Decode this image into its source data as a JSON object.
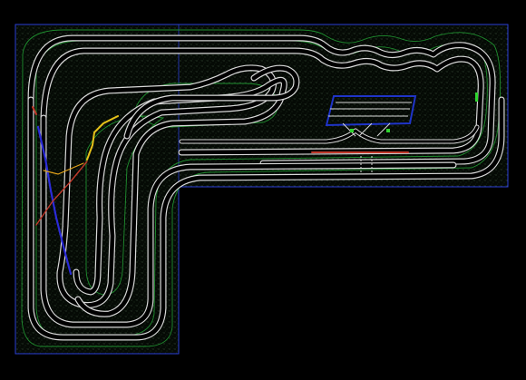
{
  "colors": {
    "background": "#000000",
    "boundary": "#2a3fd6",
    "board_fill": "#0d1a0d",
    "ground_speckle": "#6b8f6b",
    "contour": "#1f8f2f",
    "track_edge": "#d8d8d8",
    "track_bed": "#000000",
    "track_highlight": "#e6c21a",
    "track_alt": "#2b2bd8",
    "track_red": "#c0392b",
    "switch_green": "#2fd52f",
    "yard_block": "#1f34c8"
  },
  "layers": [
    "board-boundary",
    "ground-texture",
    "terrain-contours",
    "track-centerlines",
    "yard",
    "signals"
  ]
}
